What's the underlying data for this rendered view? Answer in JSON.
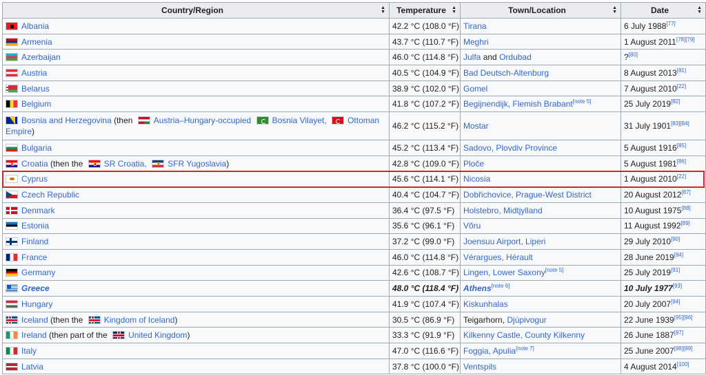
{
  "headers": {
    "country": "Country/Region",
    "temperature": "Temperature",
    "location": "Town/Location",
    "date": "Date"
  },
  "rows": [
    {
      "country": "Albania",
      "flag": "albania-flag",
      "temp": "42.2 °C (108.0 °F)",
      "locations": [
        {
          "text": "Tirana",
          "link": true
        }
      ],
      "date": "6 July 1988",
      "refs": "[77]"
    },
    {
      "country": "Armenia",
      "flag": "armenia-flag",
      "temp": "43.7 °C (110.7 °F)",
      "locations": [
        {
          "text": "Meghri",
          "link": true
        }
      ],
      "date": "1 August 2011",
      "refs": "[78][79]"
    },
    {
      "country": "Azerbaijan",
      "flag": "azerbaijan-flag",
      "temp": "46.0 °C (114.8 °F)",
      "locations": [
        {
          "text": "Julfa",
          "link": true
        },
        {
          "text": " and ",
          "link": false
        },
        {
          "text": "Ordubad",
          "link": true
        }
      ],
      "date": "?",
      "refs": "[80]"
    },
    {
      "country": "Austria",
      "flag": "austria-flag",
      "temp": "40.5 °C (104.9 °F)",
      "locations": [
        {
          "text": "Bad Deutsch-Altenburg",
          "link": true
        }
      ],
      "date": "8 August 2013",
      "refs": "[81]"
    },
    {
      "country": "Belarus",
      "flag": "belarus-flag",
      "temp": "38.9 °C (102.0 °F)",
      "locations": [
        {
          "text": "Gomel",
          "link": true
        }
      ],
      "date": "7 August 2010",
      "refs": "[22]"
    },
    {
      "country": "Belgium",
      "flag": "belgium-flag",
      "temp": "41.8 °C (107.2 °F)",
      "locations": [
        {
          "text": "Begijnendijk, Flemish Brabant",
          "link": true
        }
      ],
      "locnote": "[note 5]",
      "date": "25 July 2019",
      "refs": "[82]"
    },
    {
      "country": "Bosnia and Herzegovina",
      "flag": "bosnia-flag",
      "temp": "46.2 °C (115.2 °F)",
      "locations": [
        {
          "text": "Mostar",
          "link": true
        }
      ],
      "date": "31 July 1901",
      "refs": "[83][84]",
      "note": {
        "then": " (then ",
        "ah": "Austria–Hungary-occupied",
        "bv": "Bosnia Vilayet,",
        "oe": "Ottoman Empire",
        "close": ")"
      }
    },
    {
      "country": "Bulgaria",
      "flag": "bulgaria-flag",
      "temp": "45.2 °C (113.4 °F)",
      "locations": [
        {
          "text": "Sadovo, Plovdiv Province",
          "link": true
        }
      ],
      "date": "5 August 1916",
      "refs": "[85]"
    },
    {
      "country": "Croatia",
      "flag": "croatia-flag",
      "temp": "42.8 °C (109.0 °F)",
      "locations": [
        {
          "text": "Ploče",
          "link": true
        }
      ],
      "date": "5 August 1981",
      "refs": "[86]",
      "note": {
        "then": " (then the ",
        "src": "SR Croatia,",
        "sfr": "SFR Yugoslavia",
        "close": ")"
      }
    },
    {
      "country": "Cyprus",
      "flag": "cyprus-flag",
      "temp": "45.6 °C (114.1 °F)",
      "locations": [
        {
          "text": "Nicosia",
          "link": true
        }
      ],
      "date": "1 August 2010",
      "refs": "[22]"
    },
    {
      "country": "Czech Republic",
      "flag": "czech-flag",
      "temp": "40.4 °C (104.7 °F)",
      "locations": [
        {
          "text": "Dobřichovice, Prague-West District",
          "link": true
        }
      ],
      "date": "20 August 2012",
      "refs": "[87]"
    },
    {
      "country": "Denmark",
      "flag": "denmark-flag",
      "temp": "36.4 °C (97.5 °F)",
      "locations": [
        {
          "text": "Holstebro, Midtjylland",
          "link": true
        }
      ],
      "date": "10 August 1975",
      "refs": "[88]"
    },
    {
      "country": "Estonia",
      "flag": "estonia-flag",
      "temp": "35.6 °C (96.1 °F)",
      "locations": [
        {
          "text": "Võru",
          "link": true
        }
      ],
      "date": "11 August 1992",
      "refs": "[89]"
    },
    {
      "country": "Finland",
      "flag": "finland-flag",
      "temp": "37.2 °C (99.0 °F)",
      "locations": [
        {
          "text": "Joensuu Airport, Liperi",
          "link": true
        }
      ],
      "date": "29 July 2010",
      "refs": "[90]"
    },
    {
      "country": "France",
      "flag": "france-flag",
      "temp": "46.0 °C (114.8 °F)",
      "locations": [
        {
          "text": "Vérargues, Hérault",
          "link": true
        }
      ],
      "date": "28 June 2019",
      "refs": "[84]"
    },
    {
      "country": "Germany",
      "flag": "germany-flag",
      "temp": "42.6 °C (108.7 °F)",
      "locations": [
        {
          "text": "Lingen, Lower Saxony",
          "link": true
        }
      ],
      "locnote": "[note 5]",
      "date": "25 July 2019",
      "refs": "[91]"
    },
    {
      "country": "Greece",
      "flag": "greece-flag",
      "bold": true,
      "temp": "48.0 °C (118.4 °F)",
      "locations": [
        {
          "text": "Athens",
          "link": true
        }
      ],
      "locnote": "[note 6]",
      "date": "10 July 1977",
      "refs": "[93]"
    },
    {
      "country": "Hungary",
      "flag": "hungary-flag",
      "temp": "41.9 °C (107.4 °F)",
      "locations": [
        {
          "text": "Kiskunhalas",
          "link": true
        }
      ],
      "date": "20 July 2007",
      "refs": "[94]"
    },
    {
      "country": "Iceland",
      "flag": "iceland-flag",
      "temp": "30.5 °C (86.9 °F)",
      "locations": [
        {
          "text": "Teigarhorn, ",
          "link": false
        },
        {
          "text": "Djúpivogur",
          "link": true
        }
      ],
      "date": "22 June 1939",
      "refs": "[95][96]",
      "note": {
        "then": " (then the ",
        "ki": "Kingdom of Iceland",
        "close": ")"
      }
    },
    {
      "country": "Ireland",
      "flag": "ireland-flag",
      "temp": "33.3 °C (91.9 °F)",
      "locations": [
        {
          "text": "Kilkenny Castle, County Kilkenny",
          "link": true
        }
      ],
      "date": "26 June 1887",
      "refs": "[97]",
      "note": {
        "then": " (then part of the ",
        "uk": "United Kingdom",
        "close": ")"
      }
    },
    {
      "country": "Italy",
      "flag": "italy-flag",
      "temp": "47.0 °C (116.6 °F)",
      "locations": [
        {
          "text": "Foggia, Apulia",
          "link": true
        }
      ],
      "locnote": "[note 7]",
      "date": "25 June 2007",
      "refs": "[98][99]"
    },
    {
      "country": "Latvia",
      "flag": "latvia-flag",
      "temp": "37.8 °C (100.0 °F)",
      "locations": [
        {
          "text": "Ventspils",
          "link": true
        }
      ],
      "date": "4 August 2014",
      "refs": "[100]"
    }
  ],
  "highlight_row": "Cyprus",
  "colors": {
    "link": "#3366cc",
    "header_bg": "#eaecf0",
    "border": "#a2a9b1",
    "highlight": "#e02020"
  }
}
